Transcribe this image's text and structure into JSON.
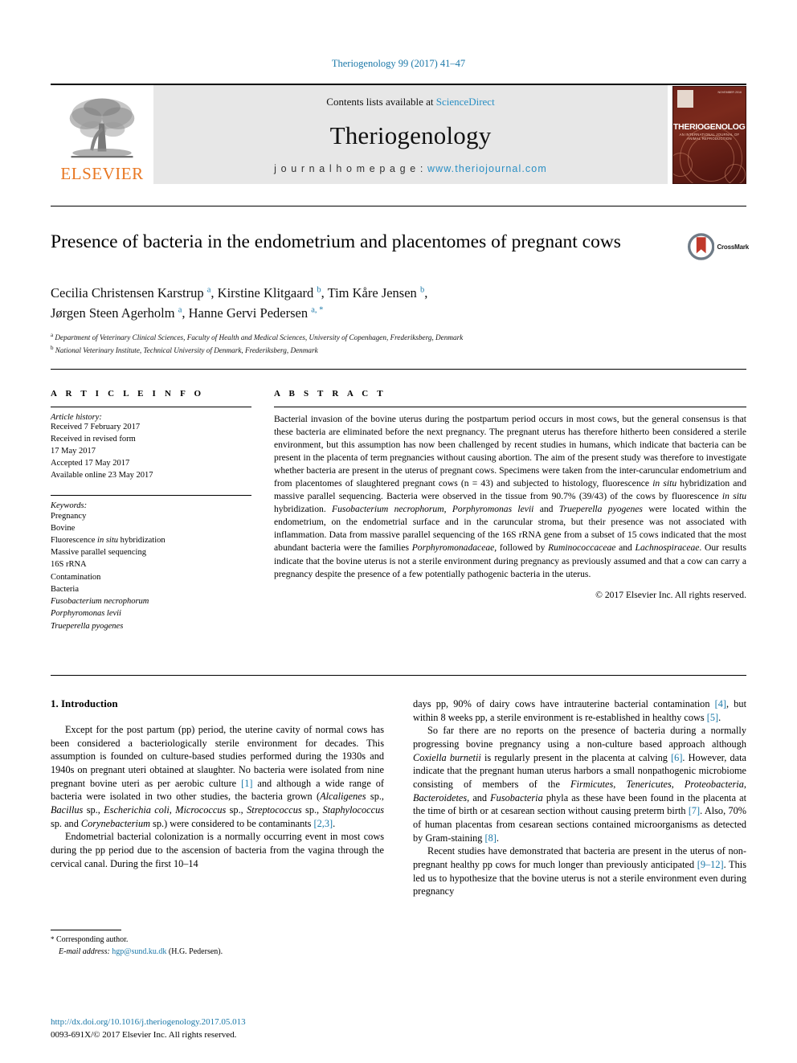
{
  "running_head": "Theriogenology 99 (2017) 41–47",
  "masthead": {
    "publisher": "ELSEVIER",
    "contents_prefix": "Contents lists available at ",
    "contents_link": "ScienceDirect",
    "journal_title": "Theriogenology",
    "homepage_label": "j o u r n a l   h o m e p a g e :  ",
    "homepage_url": "www.theriojournal.com",
    "cover_title": "THERIOGENOLOGY",
    "cover_subtitle": "AN INTERNATIONAL JOURNAL OF ANIMAL REPRODUCTION",
    "cover_date": "NOVEMBER 2016"
  },
  "article": {
    "title": "Presence of bacteria in the endometrium and placentomes of pregnant cows",
    "crossmark_label": "CrossMark",
    "authors_line1": "Cecilia Christensen Karstrup ",
    "authors_line1_sup1": "a",
    "authors_line1_mid1": ", Kirstine Klitgaard ",
    "authors_line1_sup2": "b",
    "authors_line1_mid2": ", Tim Kåre Jensen ",
    "authors_line1_sup3": "b",
    "authors_line1_end": ",",
    "authors_line2": "Jørgen Steen Agerholm ",
    "authors_line2_sup1": "a",
    "authors_line2_mid": ", Hanne Gervi Pedersen ",
    "authors_line2_sup2": "a, *",
    "affiliation_a_marker": "a",
    "affiliation_a": "Department of Veterinary Clinical Sciences, Faculty of Health and Medical Sciences, University of Copenhagen, Frederiksberg, Denmark",
    "affiliation_b_marker": "b",
    "affiliation_b": "National Veterinary Institute, Technical University of Denmark, Frederiksberg, Denmark"
  },
  "article_info": {
    "heading": "A R T I C L E   I N F O",
    "history_label": "Article history:",
    "history": [
      "Received 7 February 2017",
      "Received in revised form",
      "17 May 2017",
      "Accepted 17 May 2017",
      "Available online 23 May 2017"
    ],
    "keywords_label": "Keywords:",
    "keywords": [
      {
        "text": "Pregnancy",
        "italic": false
      },
      {
        "text": "Bovine",
        "italic": false
      },
      {
        "text": "Fluorescence in situ hybridization",
        "italic": false
      },
      {
        "text": "Massive parallel sequencing",
        "italic": false
      },
      {
        "text": "16S rRNA",
        "italic": false
      },
      {
        "text": "Contamination",
        "italic": false
      },
      {
        "text": "Bacteria",
        "italic": false
      },
      {
        "text": "Fusobacterium necrophorum",
        "italic": true
      },
      {
        "text": "Porphyromonas levii",
        "italic": true
      },
      {
        "text": "Trueperella pyogenes",
        "italic": true
      }
    ]
  },
  "abstract": {
    "heading": "A B S T R A C T",
    "text": "Bacterial invasion of the bovine uterus during the postpartum period occurs in most cows, but the general consensus is that these bacteria are eliminated before the next pregnancy. The pregnant uterus has therefore hitherto been considered a sterile environment, but this assumption has now been challenged by recent studies in humans, which indicate that bacteria can be present in the placenta of term pregnancies without causing abortion. The aim of the present study was therefore to investigate whether bacteria are present in the uterus of pregnant cows. Specimens were taken from the inter-caruncular endometrium and from placentomes of slaughtered pregnant cows (n = 43) and subjected to histology, fluorescence in situ hybridization and massive parallel sequencing. Bacteria were observed in the tissue from 90.7% (39/43) of the cows by fluorescence in situ hybridization. Fusobacterium necrophorum, Porphyromonas levii and Trueperella pyogenes were located within the endometrium, on the endometrial surface and in the caruncular stroma, but their presence was not associated with inflammation. Data from massive parallel sequencing of the 16S rRNA gene from a subset of 15 cows indicated that the most abundant bacteria were the families Porphyromonadaceae, followed by Ruminococcaceae and Lachnospiraceae. Our results indicate that the bovine uterus is not a sterile environment during pregnancy as previously assumed and that a cow can carry a pregnancy despite the presence of a few potentially pathogenic bacteria in the uterus.",
    "copyright": "© 2017 Elsevier Inc. All rights reserved."
  },
  "introduction": {
    "section_title": "1.  Introduction",
    "left_paragraphs": [
      "Except for the post partum (pp) period, the uterine cavity of normal cows has been considered a bacteriologically sterile environment for decades. This assumption is founded on culture-based studies performed during the 1930s and 1940s on pregnant uteri obtained at slaughter. No bacteria were isolated from nine pregnant bovine uteri as per aerobic culture [1] and although a wide range of bacteria were isolated in two other studies, the bacteria grown (Alcaligenes sp., Bacillus sp., Escherichia coli, Micrococcus sp., Streptococcus sp., Staphylococcus sp. and Corynebacterium sp.) were considered to be contaminants [2,3].",
      "Endometrial bacterial colonization is a normally occurring event in most cows during the pp period due to the ascension of bacteria from the vagina through the cervical canal. During the first 10–14"
    ],
    "right_paragraphs": [
      "days pp, 90% of dairy cows have intrauterine bacterial contamination [4], but within 8 weeks pp, a sterile environment is re-established in healthy cows [5].",
      "So far there are no reports on the presence of bacteria during a normally progressing bovine pregnancy using a non-culture based approach although Coxiella burnetii is regularly present in the placenta at calving [6]. However, data indicate that the pregnant human uterus harbors a small nonpathogenic microbiome consisting of members of the Firmicutes, Tenericutes, Proteobacteria, Bacteroidetes, and Fusobacteria phyla as these have been found in the placenta at the time of birth or at cesarean section without causing preterm birth [7]. Also, 70% of human placentas from cesarean sections contained microorganisms as detected by Gram-staining [8].",
      "Recent studies have demonstrated that bacteria are present in the uterus of non-pregnant healthy pp cows for much longer than previously anticipated [9–12]. This led us to hypothesize that the bovine uterus is not a sterile environment even during pregnancy"
    ]
  },
  "footer": {
    "corresponding_marker": "*",
    "corresponding_label": "Corresponding author.",
    "email_label": "E-mail address:",
    "email": "hgp@sund.ku.dk",
    "email_owner": "(H.G. Pedersen).",
    "doi": "http://dx.doi.org/10.1016/j.theriogenology.2017.05.013",
    "issn_line": "0093-691X/© 2017 Elsevier Inc. All rights reserved."
  },
  "colors": {
    "link": "#1b78a8",
    "sciencedirect": "#2a8fc4",
    "elsevier_orange": "#e87722",
    "masthead_bg": "#e7e7e7"
  }
}
